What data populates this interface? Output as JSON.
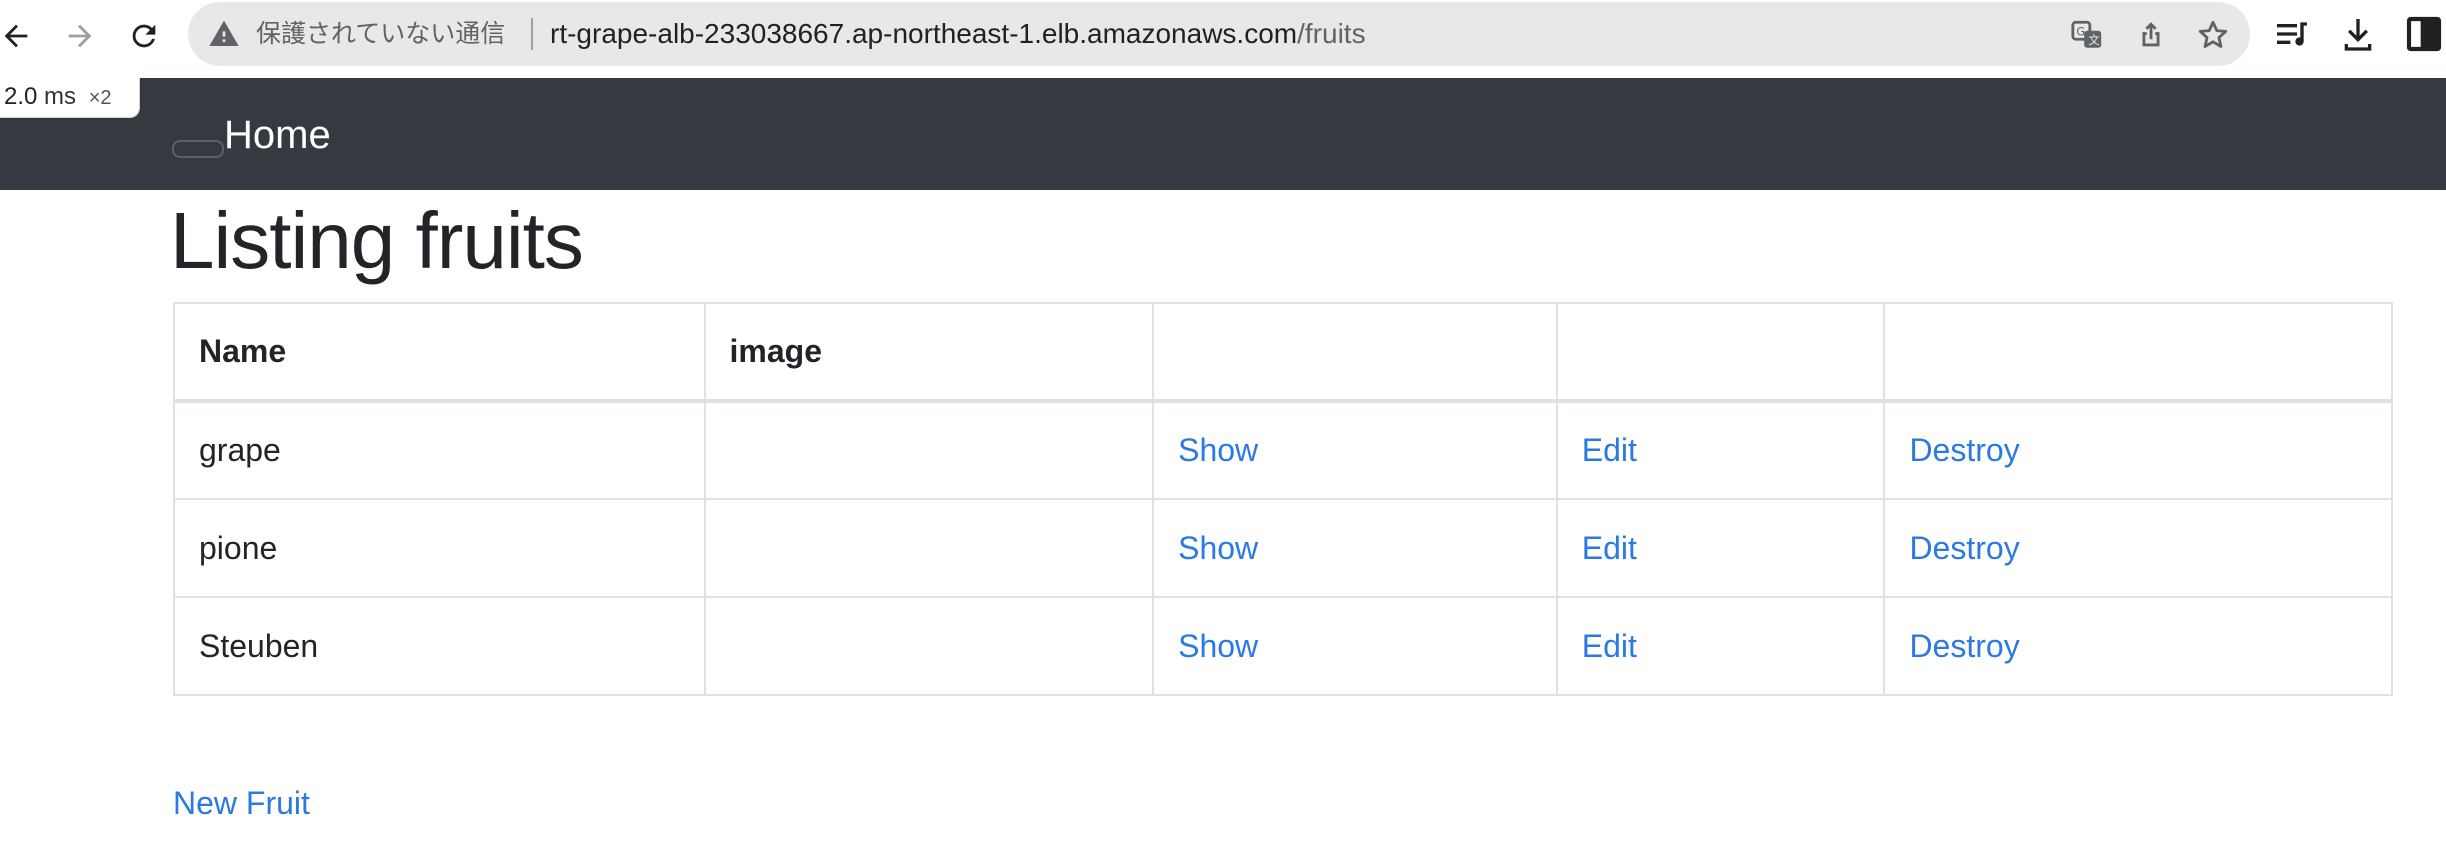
{
  "browser": {
    "security_label": "保護されていない通信",
    "url_host": "rt-grape-alb-233038667.ap-northeast-1.elb.amazonaws.com",
    "url_path": "/fruits",
    "icons": [
      "back-arrow-icon",
      "forward-arrow-icon",
      "reload-icon",
      "warning-icon",
      "translate-icon",
      "share-icon",
      "star-icon",
      "reading-list-icon",
      "download-icon",
      "side-panel-icon"
    ]
  },
  "perf_badge": {
    "time": "2.0",
    "unit": "ms",
    "multiplier": "×2"
  },
  "navbar": {
    "brand": "Home"
  },
  "page": {
    "title": "Listing fruits"
  },
  "table": {
    "headers": [
      "Name",
      "image",
      "",
      "",
      ""
    ],
    "rows": [
      {
        "name": "grape",
        "image": "",
        "show": "Show",
        "edit": "Edit",
        "destroy": "Destroy"
      },
      {
        "name": "pione",
        "image": "",
        "show": "Show",
        "edit": "Edit",
        "destroy": "Destroy"
      },
      {
        "name": "Steuben",
        "image": "",
        "show": "Show",
        "edit": "Edit",
        "destroy": "Destroy"
      }
    ]
  },
  "actions": {
    "new_label": "New Fruit"
  },
  "colors": {
    "navbar_bg": "#343a40",
    "link": "#2a7ae2",
    "omnibox_bg": "#e8e8e8"
  }
}
